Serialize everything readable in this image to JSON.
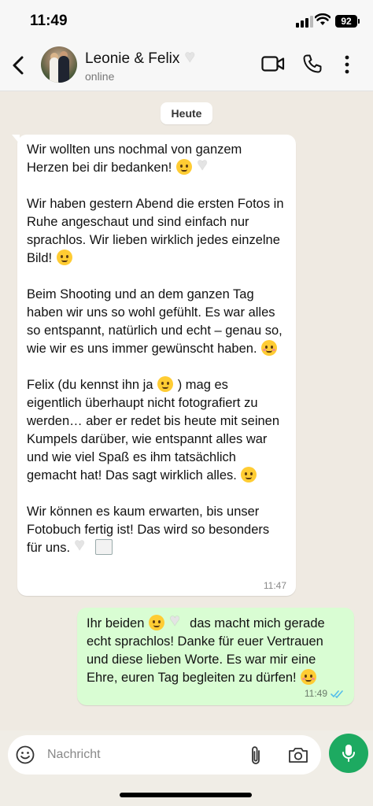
{
  "status_bar": {
    "time": "11:49",
    "battery": "92"
  },
  "header": {
    "title": "Leonie & Felix",
    "status": "online"
  },
  "chat": {
    "date_chip": "Heute",
    "incoming": {
      "paragraphs": [
        "Wir wollten uns nochmal von ganzem Herzen bei dir bedanken!",
        "Wir haben gestern Abend die ersten Fotos in Ruhe angeschaut und sind einfach nur sprachlos. Wir lieben wirklich jedes einzelne Bild!",
        "Beim Shooting und an dem ganzen Tag haben wir uns so wohl gefühlt. Es war alles so entspannt, natürlich und echt – genau so, wie wir es uns immer gewünscht haben.",
        "Felix (du kennst ihn ja",
        ") mag es eigentlich überhaupt nicht fotografiert zu werden… aber er redet bis heute mit seinen Kumpels darüber, wie entspannt alles war und wie viel Spaß es ihm tatsächlich gemacht hat! Das sagt wirklich alles.",
        "Wir können es kaum erwarten, bis unser Fotobuch fertig ist! Das wird so besonders für uns."
      ],
      "time": "11:47"
    },
    "outgoing": {
      "text_a": "Ihr beiden",
      "text_b": "das macht mich gerade echt sprachlos! Danke für euer Vertrauen und diese lieben Worte. Es war mir eine Ehre, euren Tag begleiten zu dürfen!",
      "time": "11:49",
      "read_color": "#53bdeb"
    }
  },
  "composer": {
    "placeholder": "Nachricht",
    "mic_color": "#1daa61"
  }
}
